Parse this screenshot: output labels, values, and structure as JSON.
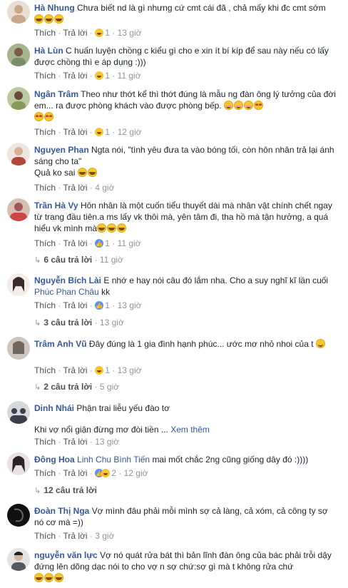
{
  "comments": [
    {
      "name": "Hà Nhung",
      "text": "Chưa biết nd là gì nhưng cứ cmt cái đã , chả mấy khi đc cmt sớm",
      "emojis": [
        "laugh",
        "laugh",
        "laugh"
      ],
      "like": "Thích",
      "reply": "Trả lời",
      "reaction_count": "1",
      "time": "13 giờ",
      "avatar": "#c9a789"
    },
    {
      "name": "Hà Lùn",
      "text": "C huấn luyện chồng c kiểu gì cho e xin ít bí kíp để sau này nếu có lấy được chồng thì e áp dụng :)))",
      "like": "Thích",
      "reply": "Trả lời",
      "reaction_count": "1",
      "time": "11 giờ",
      "avatar": "#7a8c6a"
    },
    {
      "name": "Ngân Trâm",
      "text": "Theo như thớt kể thì thớt đúng là mẫu ng đàn ông lý tưởng của đời em... ra được phòng khách vào được phòng bếp.",
      "emojis": [
        "blush",
        "blush",
        "blush",
        "heart",
        "heart",
        "heart"
      ],
      "like": "Thích",
      "reply": "Trả lời",
      "reaction_count": "1",
      "time": "12 giờ",
      "avatar": "#8a9a5b"
    },
    {
      "name": "Nguyen Phan",
      "text": "Ngta nói, \"tình yêu đưa ta vào bóng tối, còn hôn nhân trả lại ánh sáng cho ta\"",
      "text2": "Quả ko sai",
      "emojis": [
        "laugh",
        "laugh"
      ],
      "like": "Thích",
      "reply": "Trả lời",
      "time": "4 giờ",
      "avatar": "#b0473a"
    },
    {
      "name": "Trần Hà Vy",
      "text": "Hôn nhân là một cuốn tiểu thuyết dài mà nhân vật chính chết ngay từ trang đầu tiên.a ms lấy vk thôi mà, yên tâm đi, tha hồ mà tận hưởng, a quá hiểu vk mình mà",
      "emojis": [
        "laugh",
        "laugh",
        "laugh"
      ],
      "like": "Thích",
      "reply": "Trả lời",
      "reaction_count": "1",
      "time": "11 giờ",
      "replies": "6 câu trả lời",
      "replies_time": "11 giờ",
      "avatar": "#a0565a"
    },
    {
      "name": "Nguyễn Bích Lài",
      "text": "E nhớ e hay nói câu đó lắm nha. Cho a suy nghĩ kĩ lần cuối",
      "mention": "Phúc Phan Châu",
      "text_after": "kk",
      "like": "Thích",
      "reply": "Trả lời",
      "reaction_count": "1",
      "time": "13 giờ",
      "replies": "3 câu trả lời",
      "replies_time": "13 giờ",
      "avatar": "#e7d6d0"
    },
    {
      "name": "Trâm Anh Vũ",
      "text": "Đây đúng là 1 gia đình hạnh phúc... ước mơ nhỏ nhoi của t",
      "emojis": [
        "smile"
      ],
      "like": "Thích",
      "reply": "Trả lời",
      "reaction_count": "1",
      "time": "13 giờ",
      "replies": "2 câu trả lời",
      "replies_time": "5 giờ",
      "avatar": "#6b5a55"
    },
    {
      "name": "Dinh Nhái",
      "text": "Phận trai liễu yếu đào tơ",
      "text2": "Khi vợ nổi giận đừng mơ đòi tiền ...",
      "more": "Xem thêm",
      "like": "Thích",
      "reply": "Trả lời",
      "time": "13 giờ",
      "avatar": "#3a3f4a"
    },
    {
      "name": "Đông Hoa",
      "mention": "Linh Chu Bình Tiến",
      "text": "mai mốt chắc 2ng cũng giống dây đó :))))",
      "like": "Thích",
      "reply": "Trả lời",
      "reaction_count": "2",
      "time": "12 giờ",
      "replies": "12 câu trả lời",
      "avatar": "#2a2226"
    },
    {
      "name": "Đoàn Thị Nga",
      "text": "Vợ mình đâu phải mỗi mình sợ cả làng, cả xóm, cả công ty sợ nó cơ mà =))",
      "like": "Thích",
      "reply": "Trả lời",
      "time": "3 giờ",
      "avatar": "#111111"
    },
    {
      "name": "nguyễn văn lực",
      "text": "Vợ nó quát rửa bát thì bản lĩnh đàn ông của bác phải trỗi dậy đứng lên dõng dạc nói to cho vợ n sợ chứ:sợ gì mà t không rửa chứ",
      "emojis": [
        "laugh",
        "laugh",
        "laugh"
      ],
      "avatar": "#55585e"
    }
  ]
}
